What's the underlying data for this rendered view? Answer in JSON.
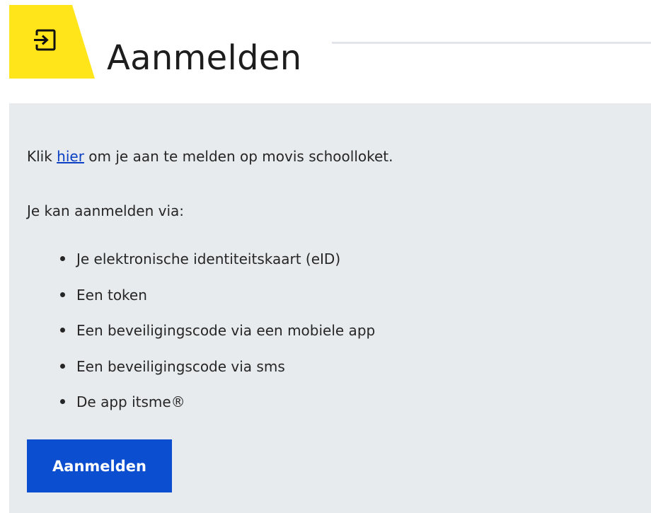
{
  "header": {
    "icon": "login-enter-icon",
    "title": "Aanmelden",
    "accent_color": "#ffe51a"
  },
  "panel": {
    "intro_before": "Klik ",
    "intro_link": "hier",
    "intro_after": " om je aan te melden op movis schoolloket.",
    "via_label": "Je kan aanmelden via:",
    "options": [
      "Je elektronische identiteitskaart (eID)",
      "Een token",
      "Een beveiligingscode via een mobiele app",
      "Een beveiligingscode via sms",
      "De app itsme®"
    ],
    "button_label": "Aanmelden",
    "button_color": "#0b4fd0",
    "link_color": "#0b3fc4",
    "background_color": "#e8ebee"
  }
}
